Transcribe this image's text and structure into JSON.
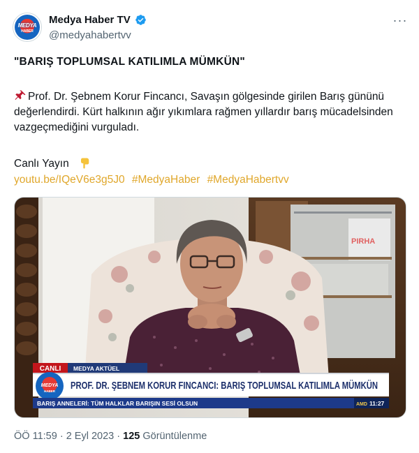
{
  "author": {
    "name": "Medya Haber TV",
    "handle": "@medyahabertvv",
    "avatar_text": "MEDYA",
    "avatar_subtext": "HABER",
    "verified_color": "#1d9bf0"
  },
  "tweet": {
    "title": "\"BARIŞ TOPLUMSAL KATILIMLA MÜMKÜN\"",
    "body": "Prof. Dr. Şebnem Korur Fincancı, Savaşın gölgesinde girilen Barış gününü değerlendirdi. Kürt halkının ağır yıkımlara rağmen yıllardır barış mücadelsinden vazgeçmediğini vurguladı.",
    "live_label": "Canlı Yayın",
    "link": "youtu.be/IQeV6e3g5J0",
    "hashtags": [
      "#MedyaHaber",
      "#MedyaHabertvv"
    ],
    "link_color": "#e0a72b"
  },
  "video": {
    "live_badge": "CANLI",
    "program": "MEDYA AKTÜEL",
    "headline": "PROF. DR. ŞEBNEM KORUR FINCANCI: BARIŞ TOPLUMSAL KATILIMLA MÜMKÜN",
    "ticker": "BARIŞ ANNELERİ: TÜM HALKLAR BARIŞIN SESİ OLSUN",
    "clock_prefix": "AMD",
    "clock": "11:27",
    "logo_text": "MEDYA",
    "logo_subtext": "HABER",
    "watermark": "PIRHA"
  },
  "meta": {
    "time": "ÖÖ 11:59",
    "separator": "·",
    "date": "2 Eyl 2023",
    "views_count": "125",
    "views_label": "Görüntülenme"
  }
}
